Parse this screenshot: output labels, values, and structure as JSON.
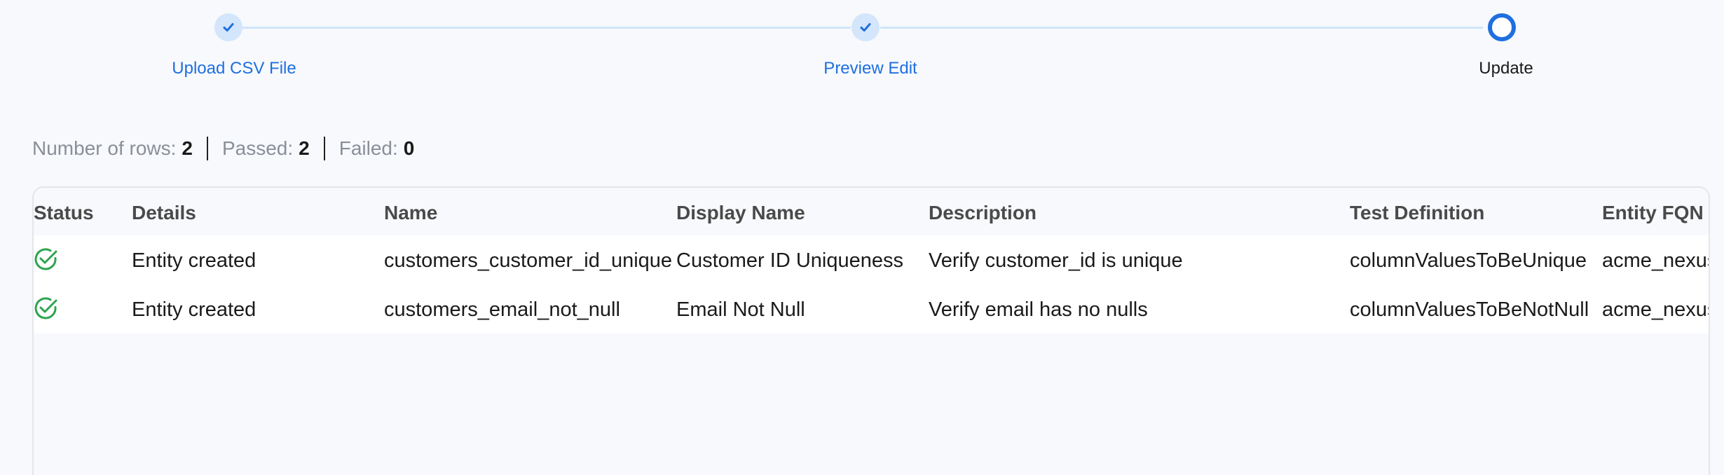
{
  "stepper": {
    "steps": [
      {
        "label": "Upload CSV File",
        "state": "done"
      },
      {
        "label": "Preview Edit",
        "state": "done"
      },
      {
        "label": "Update",
        "state": "current"
      }
    ]
  },
  "summary": {
    "rows_label": "Number of rows:",
    "rows_value": "2",
    "passed_label": "Passed:",
    "passed_value": "2",
    "failed_label": "Failed:",
    "failed_value": "0"
  },
  "table": {
    "columns": [
      "Status",
      "Details",
      "Name",
      "Display Name",
      "Description",
      "Test Definition",
      "Entity FQN"
    ],
    "rows": [
      {
        "status_icon": "success-check-icon",
        "details": "Entity created",
        "name": "customers_customer_id_unique",
        "display_name": "Customer ID Uniqueness",
        "description": "Verify customer_id is unique",
        "test_definition": "columnValuesToBeUnique",
        "entity_fqn": "acme_nexus"
      },
      {
        "status_icon": "success-check-icon",
        "details": "Entity created",
        "name": "customers_email_not_null",
        "display_name": "Email Not Null",
        "description": "Verify email has no nulls",
        "test_definition": "columnValuesToBeNotNull",
        "entity_fqn": "acme_nexus"
      }
    ]
  },
  "colors": {
    "accent": "#1f6fe0",
    "success": "#2ea44f"
  }
}
